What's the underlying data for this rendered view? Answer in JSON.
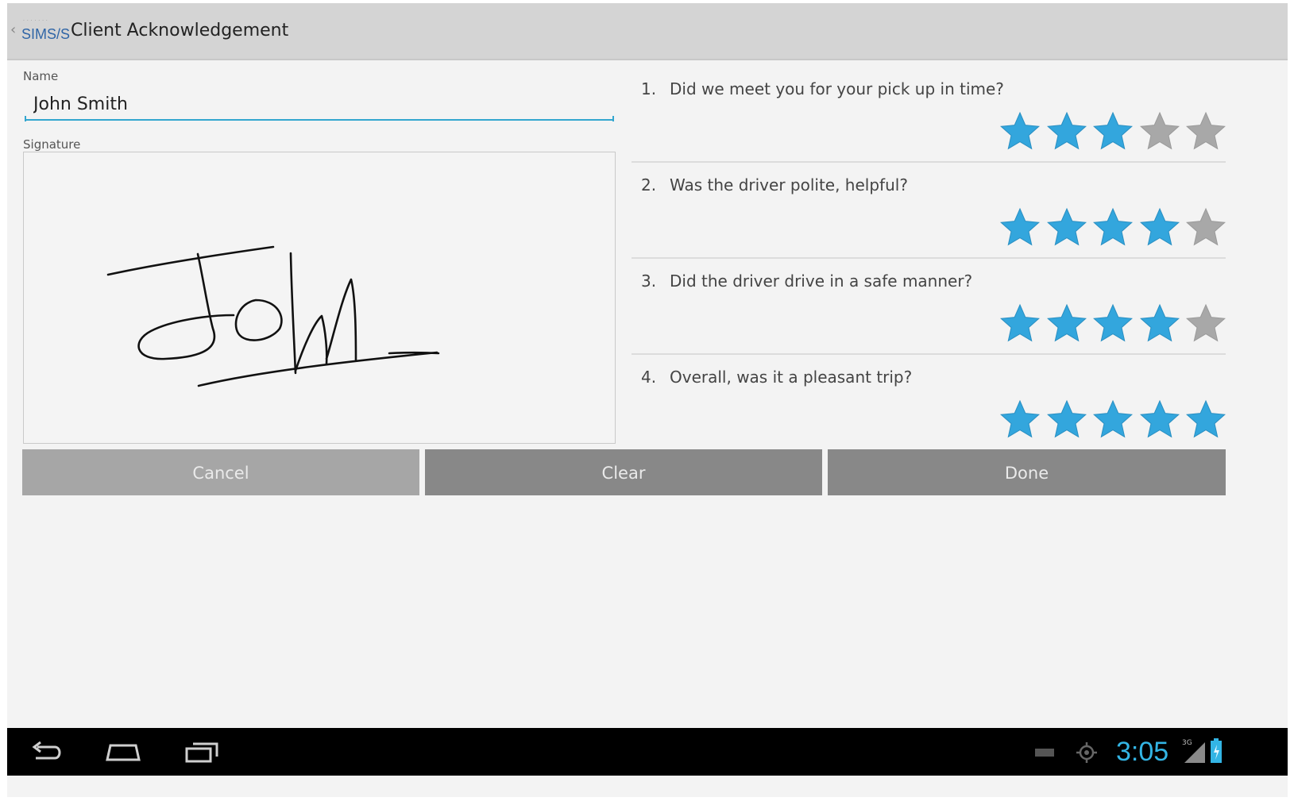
{
  "action_bar": {
    "logo_text": "SIMS/S",
    "title": "Client Acknowledgement"
  },
  "form": {
    "name_label": "Name",
    "name_value": "John Smith",
    "signature_label": "Signature"
  },
  "questions": [
    {
      "num": "1.",
      "text": "Did we meet you for your pick up in time?",
      "rating": 3,
      "max": 5
    },
    {
      "num": "2.",
      "text": "Was the driver polite, helpful?",
      "rating": 4,
      "max": 5
    },
    {
      "num": "3.",
      "text": "Did the driver drive in a safe manner?",
      "rating": 4,
      "max": 5
    },
    {
      "num": "4.",
      "text": "Overall, was it a pleasant trip?",
      "rating": 5,
      "max": 5
    }
  ],
  "buttons": {
    "cancel": "Cancel",
    "clear": "Clear",
    "done": "Done"
  },
  "status_bar": {
    "time": "3:05",
    "network": "3G",
    "icons": [
      "back-icon",
      "home-icon",
      "recent-apps-icon",
      "keyboard-icon",
      "location-icon",
      "signal-icon",
      "battery-icon"
    ]
  },
  "colors": {
    "star_on": "#33a6dd",
    "star_off": "#a8a8a8",
    "accent": "#33b5e5"
  }
}
